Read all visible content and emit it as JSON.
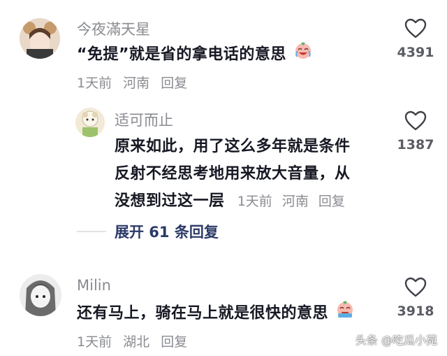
{
  "comments": [
    {
      "username": "今夜滿天星",
      "text": "“免提”就是省的拿电话的意思",
      "meta": {
        "time": "1天前",
        "location": "河南",
        "reply": "回复"
      },
      "likes": "4391"
    }
  ],
  "reply": {
    "username": "适可而止",
    "lines": [
      "原来如此，用了这么多年就是条件",
      "反射不经思考地用来放大音量，从",
      "没想到过这一层"
    ],
    "meta": {
      "time": "1天前",
      "location": "河南",
      "reply": "回复"
    },
    "likes": "1387"
  },
  "expand": {
    "label": "展开 61 条回复"
  },
  "comment2": {
    "username": "Milin",
    "text": "还有马上，骑在马上就是很快的意思",
    "meta": {
      "time": "1天前",
      "location": "湖北",
      "reply": "回复"
    },
    "likes": "3918"
  },
  "watermark": "头条 @吃瓜小苑",
  "icons": {
    "like": "heart-outline-icon",
    "emoji_laugh_cry": "laugh-cry-emoji-icon",
    "emoji_sweat": "sweat-smile-emoji-icon"
  },
  "colors": {
    "text": "#161823",
    "secondary": "#8a8b91",
    "expand": "#2b3a67"
  }
}
